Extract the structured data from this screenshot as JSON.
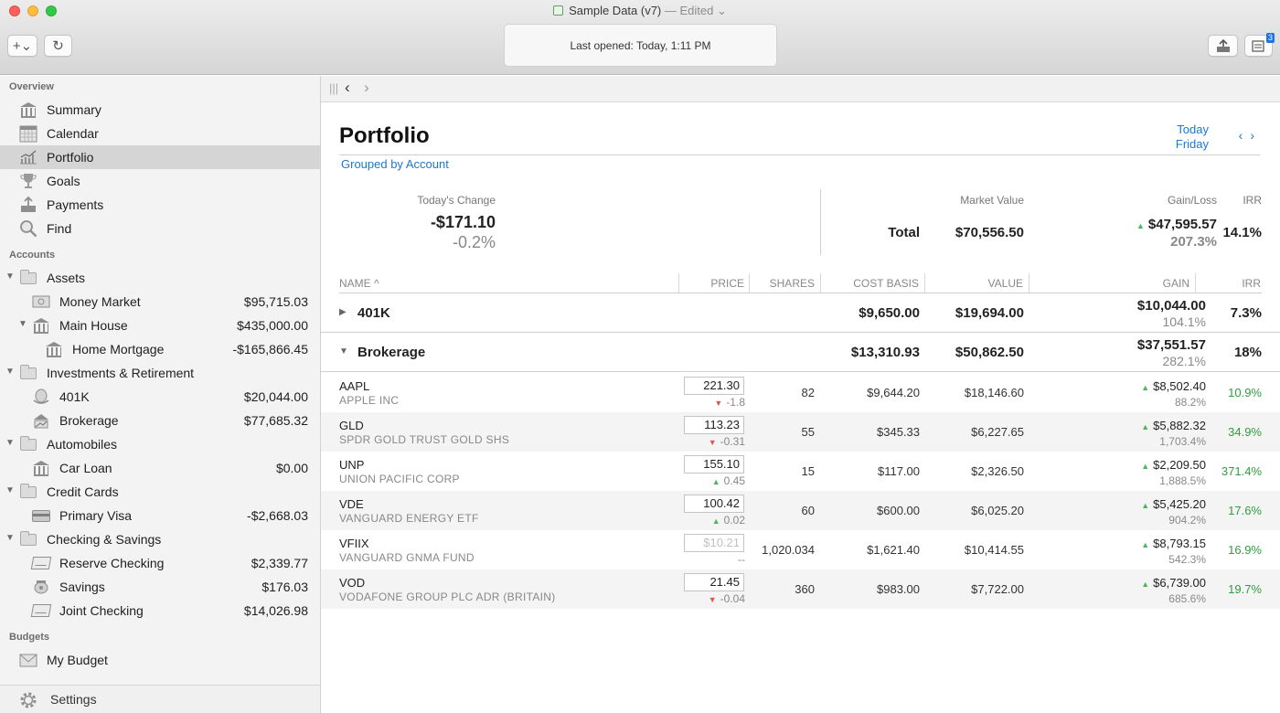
{
  "window": {
    "title": "Sample Data (v7)",
    "title_suffix": "— Edited ⌄",
    "status": "Last opened: Today, 1:11 PM",
    "badge_count": "3",
    "add_label": "+⌄",
    "refresh_label": "↻"
  },
  "sidebar": {
    "sections": {
      "overview": "Overview",
      "accounts": "Accounts",
      "budgets": "Budgets"
    },
    "overview_items": [
      {
        "label": "Summary",
        "icon": "bank-icon"
      },
      {
        "label": "Calendar",
        "icon": "calendar-icon"
      },
      {
        "label": "Portfolio",
        "icon": "chart-icon"
      },
      {
        "label": "Goals",
        "icon": "trophy-icon"
      },
      {
        "label": "Payments",
        "icon": "upload-icon"
      },
      {
        "label": "Find",
        "icon": "magnifier-icon"
      }
    ],
    "accounts": [
      {
        "label": "Assets",
        "amount": ""
      },
      {
        "label": "Money Market",
        "amount": "$95,715.03"
      },
      {
        "label": "Main House",
        "amount": "$435,000.00"
      },
      {
        "label": "Home Mortgage",
        "amount": "-$165,866.45"
      },
      {
        "label": "Investments & Retirement",
        "amount": ""
      },
      {
        "label": "401K",
        "amount": "$20,044.00"
      },
      {
        "label": "Brokerage",
        "amount": "$77,685.32"
      },
      {
        "label": "Automobiles",
        "amount": ""
      },
      {
        "label": "Car Loan",
        "amount": "$0.00"
      },
      {
        "label": "Credit Cards",
        "amount": ""
      },
      {
        "label": "Primary Visa",
        "amount": "-$2,668.03"
      },
      {
        "label": "Checking & Savings",
        "amount": ""
      },
      {
        "label": "Reserve Checking",
        "amount": "$2,339.77"
      },
      {
        "label": "Savings",
        "amount": "$176.03"
      },
      {
        "label": "Joint Checking",
        "amount": "$14,026.98"
      }
    ],
    "budget_items": [
      {
        "label": "My Budget",
        "icon": "envelope-icon"
      }
    ],
    "settings_label": "Settings"
  },
  "portfolio": {
    "title": "Portfolio",
    "grouping": "Grouped by Account",
    "date_line1": "Today",
    "date_line2": "Friday",
    "summary": {
      "todays_change_label": "Today's Change",
      "todays_change_value": "-$171.10",
      "todays_change_pct": "-0.2%",
      "total_label": "Total",
      "market_value_label": "Market Value",
      "market_value": "$70,556.50",
      "gain_loss_label": "Gain/Loss",
      "gain_loss_value": "$47,595.57",
      "gain_loss_pct": "207.3%",
      "irr_label": "IRR",
      "irr_value": "14.1%"
    },
    "columns": [
      "NAME ^",
      "PRICE",
      "SHARES",
      "COST BASIS",
      "VALUE",
      "GAIN",
      "IRR"
    ],
    "groups": [
      {
        "name": "401K",
        "cost_basis": "$9,650.00",
        "value": "$19,694.00",
        "gain": "$10,044.00",
        "gain_pct": "104.1%",
        "irr": "7.3%"
      },
      {
        "name": "Brokerage",
        "cost_basis": "$13,310.93",
        "value": "$50,862.50",
        "gain": "$37,551.57",
        "gain_pct": "282.1%",
        "irr": "18%"
      }
    ],
    "holdings": [
      {
        "symbol": "AAPL",
        "name": "APPLE INC",
        "price": "221.30",
        "change": "-1.8",
        "dir": "down",
        "shares": "82",
        "cost_basis": "$9,644.20",
        "value": "$18,146.60",
        "gain": "$8,502.40",
        "gain_pct": "88.2%",
        "irr": "10.9%"
      },
      {
        "symbol": "GLD",
        "name": "SPDR GOLD TRUST GOLD SHS",
        "price": "113.23",
        "change": "-0.31",
        "dir": "down",
        "shares": "55",
        "cost_basis": "$345.33",
        "value": "$6,227.65",
        "gain": "$5,882.32",
        "gain_pct": "1,703.4%",
        "irr": "34.9%"
      },
      {
        "symbol": "UNP",
        "name": "UNION PACIFIC CORP",
        "price": "155.10",
        "change": "0.45",
        "dir": "up",
        "shares": "15",
        "cost_basis": "$117.00",
        "value": "$2,326.50",
        "gain": "$2,209.50",
        "gain_pct": "1,888.5%",
        "irr": "371.4%"
      },
      {
        "symbol": "VDE",
        "name": "VANGUARD ENERGY ETF",
        "price": "100.42",
        "change": "0.02",
        "dir": "up",
        "shares": "60",
        "cost_basis": "$600.00",
        "value": "$6,025.20",
        "gain": "$5,425.20",
        "gain_pct": "904.2%",
        "irr": "17.6%"
      },
      {
        "symbol": "VFIIX",
        "name": "VANGUARD GNMA FUND",
        "price": "$10.21",
        "change": "--",
        "dir": "none",
        "shares": "1,020.034",
        "cost_basis": "$1,621.40",
        "value": "$10,414.55",
        "gain": "$8,793.15",
        "gain_pct": "542.3%",
        "irr": "16.9%"
      },
      {
        "symbol": "VOD",
        "name": "VODAFONE GROUP PLC ADR (BRITAIN)",
        "price": "21.45",
        "change": "-0.04",
        "dir": "down",
        "shares": "360",
        "cost_basis": "$983.00",
        "value": "$7,722.00",
        "gain": "$6,739.00",
        "gain_pct": "685.6%",
        "irr": "19.7%"
      }
    ]
  },
  "colors": {
    "accent": "#1b78d0",
    "gain_green": "#2e9e3e",
    "up_arrow": "#49b85a",
    "down_arrow": "#e05555",
    "selection": "#d5d5d5"
  }
}
